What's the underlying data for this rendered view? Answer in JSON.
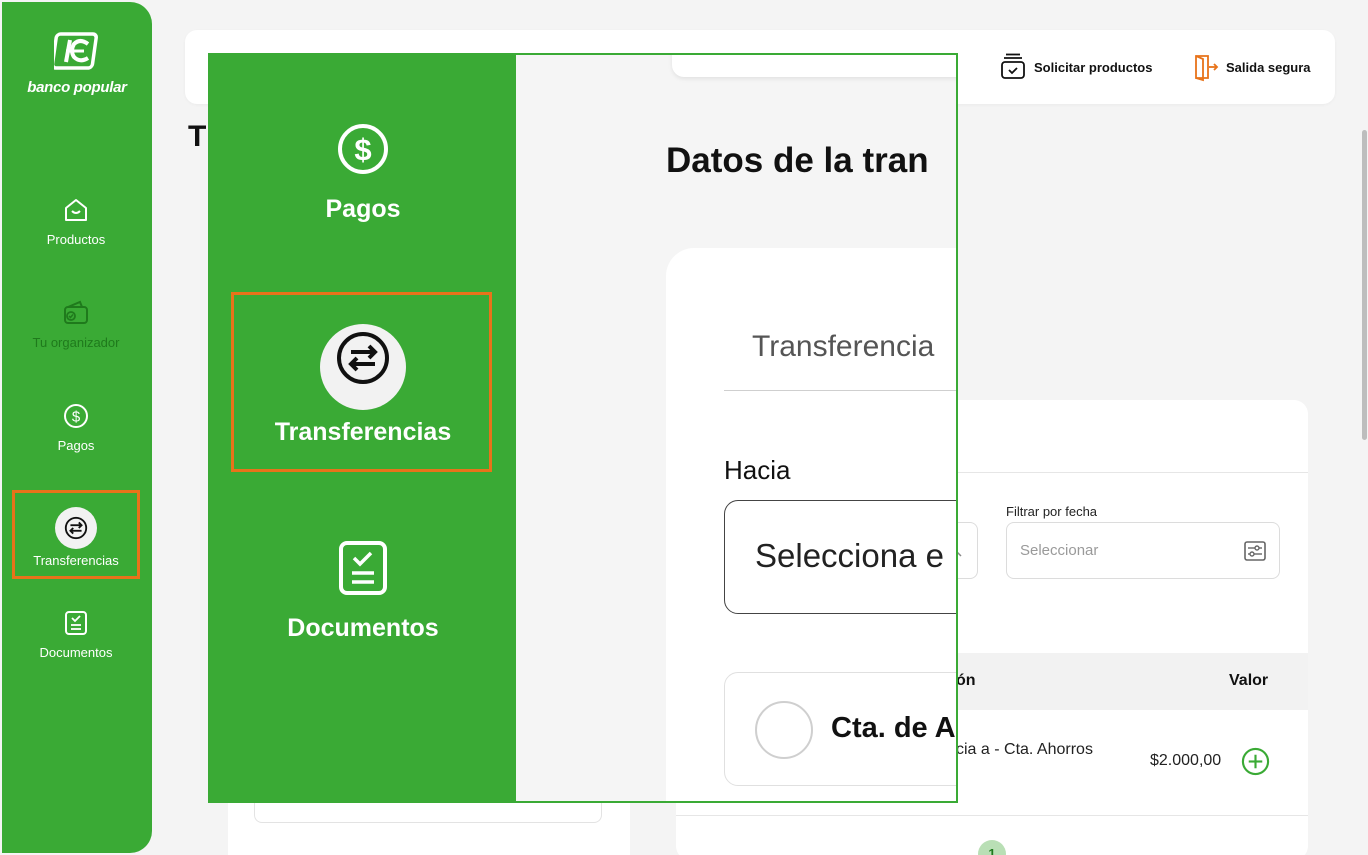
{
  "brand": {
    "name": "banco popular",
    "green": "#3aaa35",
    "accent": "#e8731a"
  },
  "sidebar": {
    "items": [
      {
        "label": "Productos",
        "icon": "home-icon"
      },
      {
        "label": "Tu organizador",
        "icon": "wallet-icon"
      },
      {
        "label": "Pagos",
        "icon": "dollar-icon"
      },
      {
        "label": "Transferencias",
        "icon": "transfer-icon",
        "active": true
      },
      {
        "label": "Documentos",
        "icon": "document-icon"
      }
    ]
  },
  "header": {
    "request_products": "Solicitar productos",
    "secure_exit": "Salida segura"
  },
  "page": {
    "title_fragment": "T"
  },
  "zoom": {
    "items": [
      {
        "label": "Pagos",
        "icon": "dollar-icon"
      },
      {
        "label": "Transferencias",
        "icon": "transfer-icon",
        "active": true
      },
      {
        "label": "Documentos",
        "icon": "document-icon"
      }
    ],
    "title": "Datos de la tran",
    "tab": "Transferencia",
    "to_label": "Hacia",
    "select_placeholder": "Selecciona e",
    "account_name": "Cta. de A"
  },
  "movements": {
    "filter_label": "Filtrar por fecha",
    "filter_placeholder": "Seleccionar",
    "col_description": "ón",
    "col_value": "Valor",
    "rows": [
      {
        "description": "cia a - Cta. Ahorros",
        "value": "$2.000,00"
      }
    ],
    "current_page": "1"
  }
}
